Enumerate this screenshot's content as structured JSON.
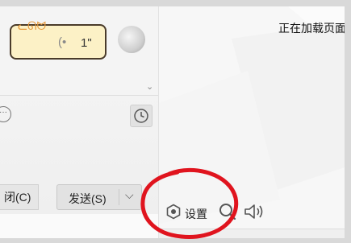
{
  "chat": {
    "voice_message": {
      "duration": "1\""
    },
    "buttons": {
      "close_label": "闭(C)",
      "send_label": "发送(S)"
    }
  },
  "content": {
    "loading_text": "正在加载页面"
  },
  "toolbar": {
    "settings_label": "设置"
  },
  "icons": {
    "voice": "voice-wave-icon",
    "collapse": "chevron-down-icon",
    "more": "more-icon",
    "history": "clock-icon",
    "send_options": "chevron-down-icon",
    "settings": "hexagon-gear-icon",
    "search": "search-icon",
    "speaker": "speaker-icon"
  },
  "colors": {
    "bubble_fill": "#fcf1c6",
    "bubble_border": "#4a3b2a",
    "annotation_red": "#e0141e"
  }
}
